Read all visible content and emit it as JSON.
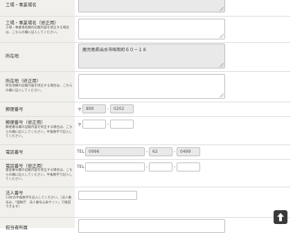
{
  "form": {
    "factory_name": {
      "label": "工場・事業場名"
    },
    "factory_name_fix": {
      "label": "工場・事業場名（修正用）",
      "note": "工場・事業場名欄の記載内容を修正する場合は、こちらの欄に記入してください。"
    },
    "address": {
      "label": "所在地",
      "value": "鹿児島県出水市昭和町６０－１８"
    },
    "address_fix": {
      "label": "所在地（修正用）",
      "note": "所在地欄の記載内容を修正する場合は、こちらの欄に記入してください。"
    },
    "postal": {
      "label": "郵便番号",
      "prefix": "〒",
      "part1": "899",
      "sep": "-",
      "part2": "0202"
    },
    "postal_fix": {
      "label": "郵便番号（修正用）",
      "note": "郵便番号欄の記載内容を修正する場合は、こちらの欄に記入してください。半角数字で記入してください。",
      "prefix": "〒",
      "sep": "-"
    },
    "phone": {
      "label": "電話番号",
      "prefix": "TEL",
      "part1": "0996",
      "sep": "-",
      "part2": "62",
      "part3": "0499"
    },
    "phone_fix": {
      "label": "電話番号（修正用）",
      "note": "電話番号欄の記載内容を修正する場合は、こちらの欄に記入してください。半角数字で記入してください。",
      "prefix": "TEL",
      "sep": "-"
    },
    "corp_number": {
      "label": "法人番号",
      "note": "13桁の半角数字を記入してください。（法人番号は、「国税庁　法人番号公表サイト」で確認できます）"
    },
    "person_in_charge": {
      "label": "担当者所属"
    }
  },
  "icons": {
    "scroll_top": "arrow-up-icon"
  },
  "colors": {
    "label_bg": "#f1f0ec",
    "readonly_bg": "#e9e9e9",
    "border": "#bdbdbd",
    "button_bg": "#3a3a3a"
  }
}
